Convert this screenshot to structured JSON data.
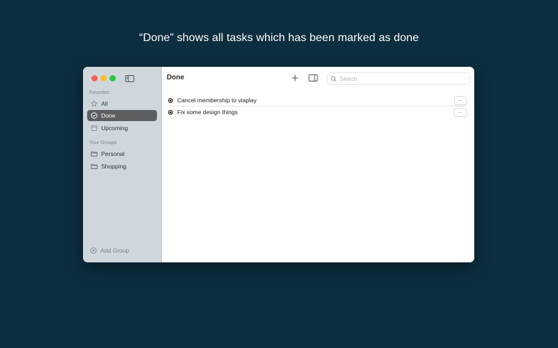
{
  "caption": "“Done” shows all tasks which has been marked as done",
  "sidebar": {
    "favorites_label": "Favorites",
    "favorites": [
      {
        "label": "All",
        "icon": "star-icon",
        "active": false
      },
      {
        "label": "Done",
        "icon": "checkmark-circle-icon",
        "active": true
      },
      {
        "label": "Upcoming",
        "icon": "calendar-icon",
        "active": false
      }
    ],
    "groups_label": "Your Groups",
    "groups": [
      {
        "label": "Personal",
        "icon": "folder-icon"
      },
      {
        "label": "Shopping",
        "icon": "folder-icon"
      }
    ],
    "add_group_label": "Add Group"
  },
  "main": {
    "title": "Done",
    "search_placeholder": "Search",
    "tasks": [
      {
        "text": "Cancel membership to viaplay",
        "more": "..."
      },
      {
        "text": "Fix some design things",
        "more": "..."
      }
    ]
  },
  "colors": {
    "background": "#0c2f40",
    "sidebar": "#cfd7dd",
    "active_item": "#5b5f61"
  }
}
